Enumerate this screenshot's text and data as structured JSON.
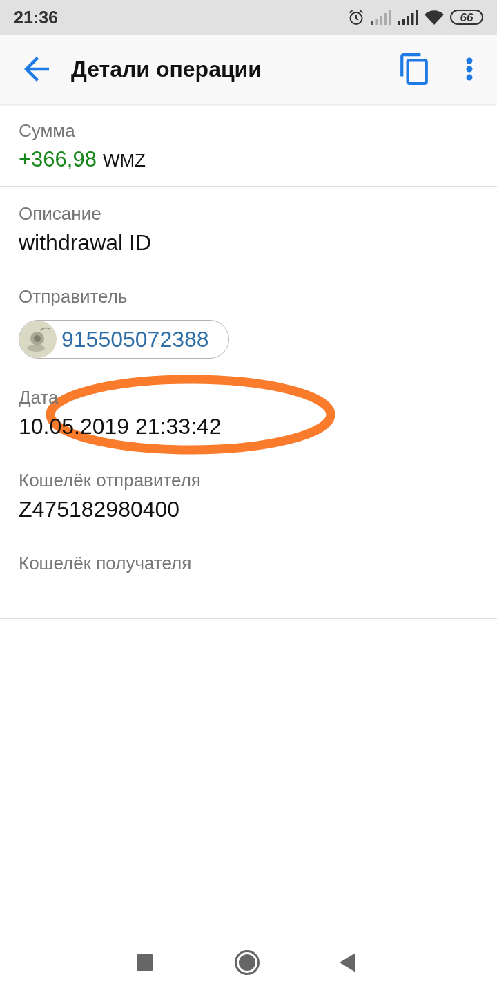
{
  "status_bar": {
    "time": "21:36",
    "battery": "66"
  },
  "app_bar": {
    "title": "Детали операции"
  },
  "details": [
    {
      "kind": "amount",
      "label": "Сумма",
      "amount": "+366,98",
      "currency": "WMZ",
      "highlighted": false
    },
    {
      "kind": "text",
      "label": "Описание",
      "value": "withdrawal ID",
      "highlighted": false
    },
    {
      "kind": "contact",
      "label": "Отправитель",
      "value": "915505072388",
      "highlighted": false
    },
    {
      "kind": "text",
      "label": "Дата",
      "value": "10.05.2019 21:33:42",
      "highlighted": true
    },
    {
      "kind": "text",
      "label": "Кошелёк отправителя",
      "value": "Z475182980400",
      "highlighted": false
    },
    {
      "kind": "text",
      "label": "Кошелёк получателя",
      "highlighted": false
    }
  ]
}
